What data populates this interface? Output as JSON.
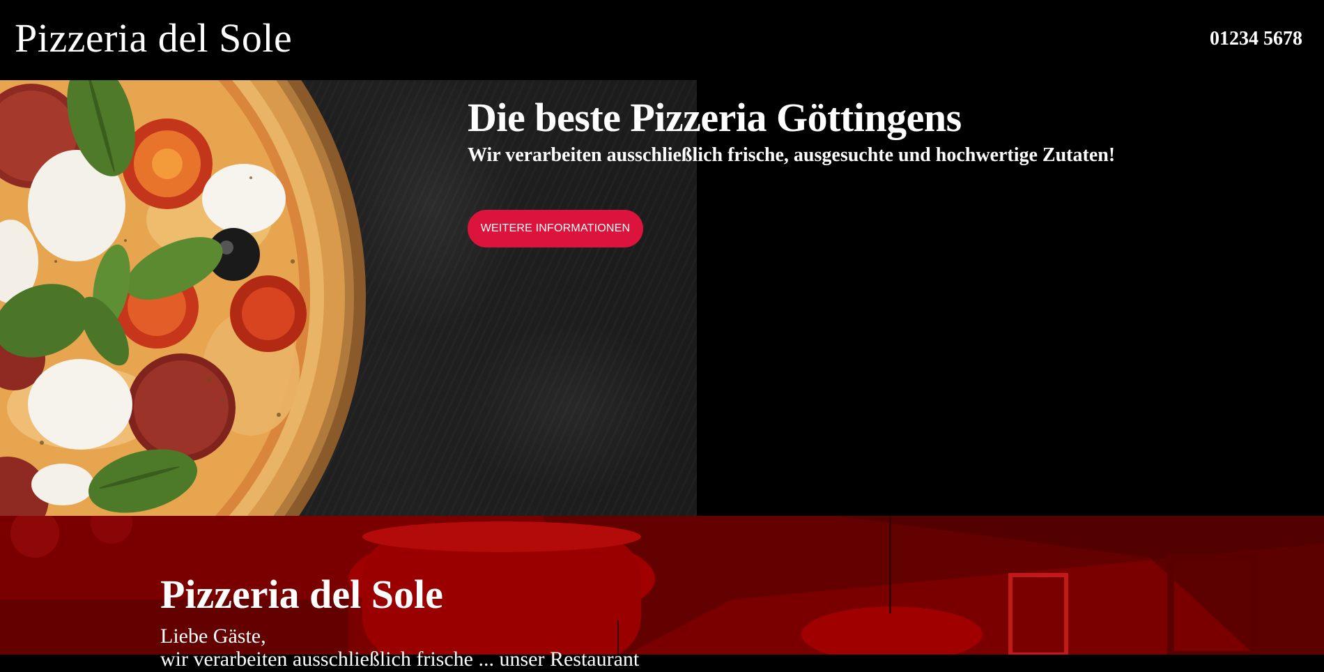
{
  "header": {
    "brand": "Pizzeria del Sole",
    "phone": "01234 5678"
  },
  "hero": {
    "title": "Die beste Pizzeria Göttingens",
    "subtitle": "Wir verarbeiten ausschließlich frische, ausgesuchte und hochwertige Zutaten!",
    "cta_label": "WEITERE INFORMATIONEN",
    "image_alt": "pizza-with-basil-tomato-salami-mozzarella"
  },
  "about": {
    "title": "Pizzeria del Sole",
    "greeting": "Liebe Gäste,",
    "body_partial": "wir verarbeiten ausschließlich frische ... unser Restaurant"
  },
  "colors": {
    "page_background": "#000000",
    "accent": "#dc143c",
    "section_red": "#8b0000",
    "text": "#ffffff"
  }
}
